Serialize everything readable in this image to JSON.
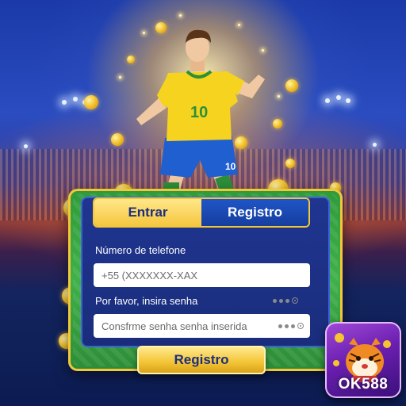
{
  "tabs": {
    "login": "Entrar",
    "register": "Registro"
  },
  "phone": {
    "label": "Número de telefone",
    "placeholder": "+55 (XXXXXXX-XAX"
  },
  "password": {
    "label": "Por favor, insira senha"
  },
  "confirm": {
    "placeholder": "Consfrme senha senha inserida"
  },
  "submit": {
    "label": "Registro"
  },
  "brand": {
    "name": "OK588"
  },
  "player": {
    "number": "10"
  },
  "colors": {
    "gold": "#f6c63e",
    "navy": "#1c2f7e",
    "green": "#3fb04a",
    "badge": "#6b1fb0"
  }
}
